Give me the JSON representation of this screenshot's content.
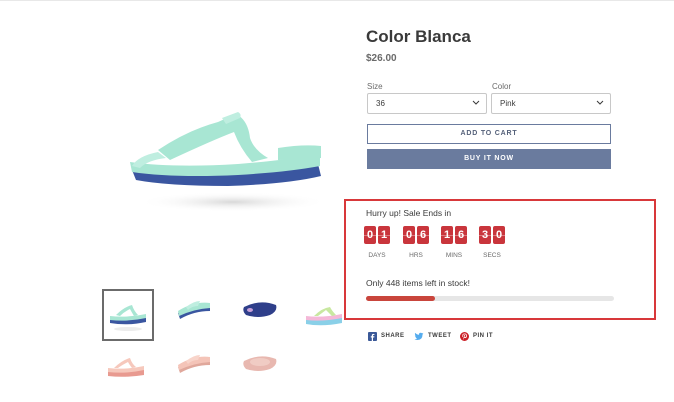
{
  "product": {
    "title": "Color Blanca",
    "price": "$26.00"
  },
  "options": {
    "size": {
      "label": "Size",
      "value": "36"
    },
    "color": {
      "label": "Color",
      "value": "Pink"
    }
  },
  "buttons": {
    "add_to_cart": "ADD TO CART",
    "buy_now": "BUY IT NOW"
  },
  "countdown": {
    "heading": "Hurry up! Sale Ends in",
    "units": [
      {
        "digits": [
          "0",
          "1"
        ],
        "label": "DAYS"
      },
      {
        "digits": [
          "0",
          "6"
        ],
        "label": "HRS"
      },
      {
        "digits": [
          "1",
          "6"
        ],
        "label": "MINS"
      },
      {
        "digits": [
          "3",
          "0"
        ],
        "label": "SECS"
      }
    ]
  },
  "stock": {
    "text": "Only 448 items left in stock!",
    "progress_percent": 28
  },
  "share": {
    "facebook": "SHARE",
    "twitter": "TWEET",
    "pinterest": "PIN IT"
  },
  "colors": {
    "accent": "#6a7b9e",
    "countdown_red": "#c9353c",
    "highlight_border": "#d8383a",
    "sandal_mint": "#a8e6d3",
    "sandal_sole": "#3a56a0"
  },
  "thumbnails": [
    {
      "name": "mint-sandal-side",
      "active": true
    },
    {
      "name": "mint-sandal-angle"
    },
    {
      "name": "navy-sandal"
    },
    {
      "name": "multicolor-sandal"
    },
    {
      "name": "pink-sandal-side"
    },
    {
      "name": "pink-sandal-angle"
    },
    {
      "name": "pink-sandal-top"
    }
  ]
}
